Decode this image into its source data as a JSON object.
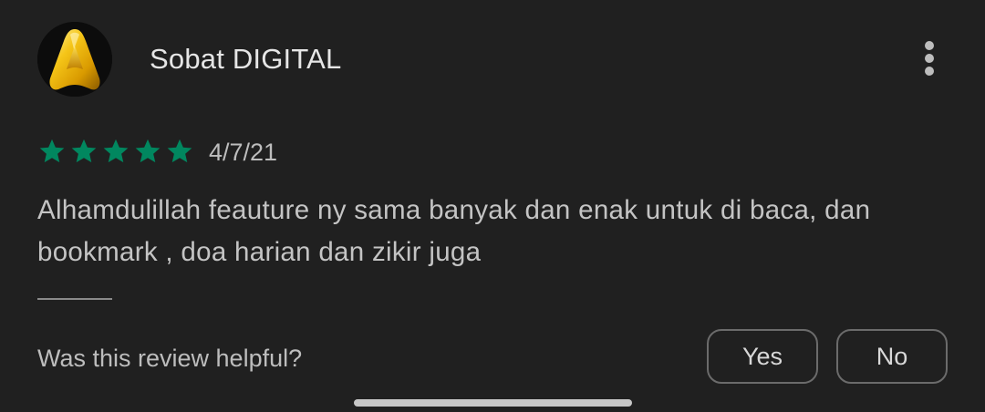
{
  "review": {
    "author": "Sobat DIGITAL",
    "avatar_icon": "golden-a-logo-icon",
    "rating": 5,
    "max_rating": 5,
    "date": "4/7/21",
    "text": "Alhamdulillah feauture ny sama banyak dan enak untuk di baca, dan bookmark , doa harian dan zikir juga"
  },
  "helpful": {
    "question": "Was this review helpful?",
    "yes_label": "Yes",
    "no_label": "No"
  },
  "icons": {
    "more": "more-vertical-icon",
    "star": "star-icon"
  },
  "colors": {
    "background": "#202020",
    "star": "#01875f",
    "text_primary": "#e6e6e6",
    "text_secondary": "#c4c4c4"
  }
}
